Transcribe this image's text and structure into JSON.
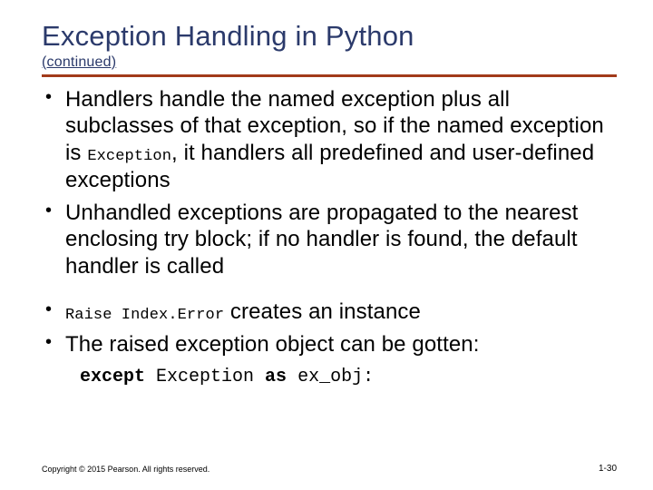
{
  "title": "Exception Handling in Python",
  "subtitle": "(continued)",
  "bullets": {
    "b1_a": "Handlers handle the named exception plus all subclasses of that exception, so if the named exception is ",
    "b1_code": "Exception",
    "b1_b": ", it handlers all predefined and user-defined exceptions",
    "b2": "Unhandled exceptions are propagated to the nearest enclosing try block; if no handler is found, the default handler is called",
    "b3_code": "Raise Index.Error",
    "b3_tail": " creates an instance",
    "b4": "The raised exception object can be gotten:"
  },
  "code": {
    "kw1": "except",
    "cls": " Exception ",
    "kw2": "as",
    "tail": " ex_obj:"
  },
  "footer": "Copyright © 2015 Pearson. All rights reserved.",
  "pagenum": "1-30"
}
